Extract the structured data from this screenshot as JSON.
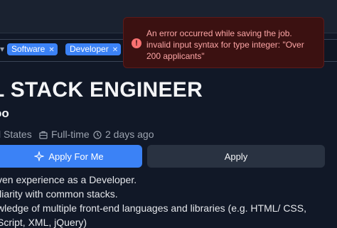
{
  "tags": [
    {
      "label": "Software"
    },
    {
      "label": "Developer"
    }
  ],
  "job": {
    "title": "L STACK ENGINEER",
    "company": "oo",
    "location": "l States",
    "type": "Full-time",
    "posted": "2 days ago"
  },
  "actions": {
    "apply_for_me": "Apply For Me",
    "apply": "Apply"
  },
  "description_lines": [
    "ven experience as a Developer.",
    "iliarity with common stacks.",
    "wledge of multiple front-end languages and libraries (e.g. HTML/ CSS,",
    "Script, XML, jQuery)"
  ],
  "toast": {
    "message": "An error occurred while saving the job. invalid input syntax for type integer: \"Over 200 applicants\""
  },
  "colors": {
    "accent": "#3b82f6",
    "error_bg": "#3b1111",
    "error_text": "#fca5a5"
  }
}
